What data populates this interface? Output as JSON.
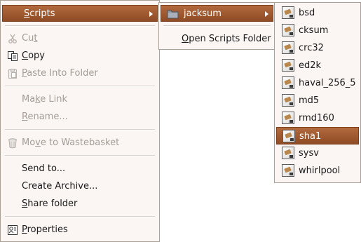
{
  "main_menu": {
    "scripts": {
      "pre": "",
      "u": "S",
      "post": "cripts"
    },
    "cut": {
      "pre": "Cu",
      "u": "t",
      "post": ""
    },
    "copy": {
      "pre": "",
      "u": "C",
      "post": "opy"
    },
    "paste_into_folder": {
      "pre": "",
      "u": "P",
      "post": "aste Into Folder"
    },
    "make_link": {
      "pre": "Ma",
      "u": "k",
      "post": "e Link"
    },
    "rename": {
      "pre": "",
      "u": "R",
      "post": "ename..."
    },
    "move_to_wastebasket": {
      "pre": "Mo",
      "u": "v",
      "post": "e to Wastebasket"
    },
    "send_to": "Send to...",
    "create_archive": "Create Archive...",
    "share_folder": {
      "pre": "",
      "u": "S",
      "post": "hare folder"
    },
    "properties": {
      "pre": "",
      "u": "P",
      "post": "roperties"
    }
  },
  "scripts_menu": {
    "jacksum": "jacksum",
    "open_scripts_folder": {
      "pre": "",
      "u": "O",
      "post": "pen Scripts Folder"
    }
  },
  "jacksum_menu": {
    "items": [
      "bsd",
      "cksum",
      "crc32",
      "ed2k",
      "haval_256_5",
      "md5",
      "rmd160",
      "sha1",
      "sysv",
      "whirlpool"
    ],
    "highlighted_index": 7
  },
  "colors": {
    "highlight": "#9e5a31",
    "menu_bg": "#fbf6f3",
    "disabled_text": "#a39c96"
  },
  "icons": {
    "cut": "scissors-icon",
    "copy": "copy-icon",
    "paste": "paste-icon",
    "move_to_wastebasket": "trash-icon",
    "properties": "properties-icon",
    "folder": "folder-icon",
    "script": "script-icon"
  }
}
